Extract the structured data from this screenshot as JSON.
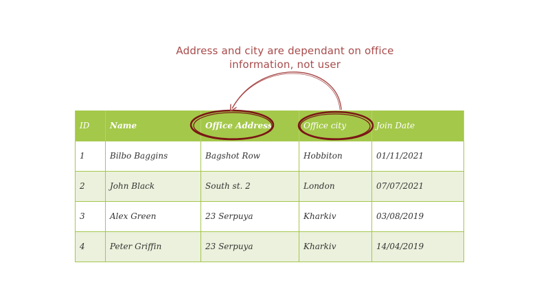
{
  "annotation": {
    "line1": "Address and city are dependant on office",
    "line2": "information, not user"
  },
  "table": {
    "headers": [
      "ID",
      "Name",
      "Office Address",
      "Office city",
      "Join Date"
    ],
    "rows": [
      [
        "1",
        "Bilbo Baggins",
        "Bagshot Row",
        "Hobbiton",
        "01/11/2021"
      ],
      [
        "2",
        "John Black",
        "South st. 2",
        "London",
        "07/07/2021"
      ],
      [
        "3",
        "Alex Green",
        "23 Serpuya",
        "Kharkiv",
        "03/08/2019"
      ],
      [
        "4",
        "Peter Griffin",
        "23 Serpuya",
        "Kharkiv",
        "14/04/2019"
      ]
    ]
  },
  "colors": {
    "header": "#a4c84a",
    "stripe": "#ebf1dc",
    "highlight": "#7a1616",
    "annotation_text": "#a84a4a"
  }
}
